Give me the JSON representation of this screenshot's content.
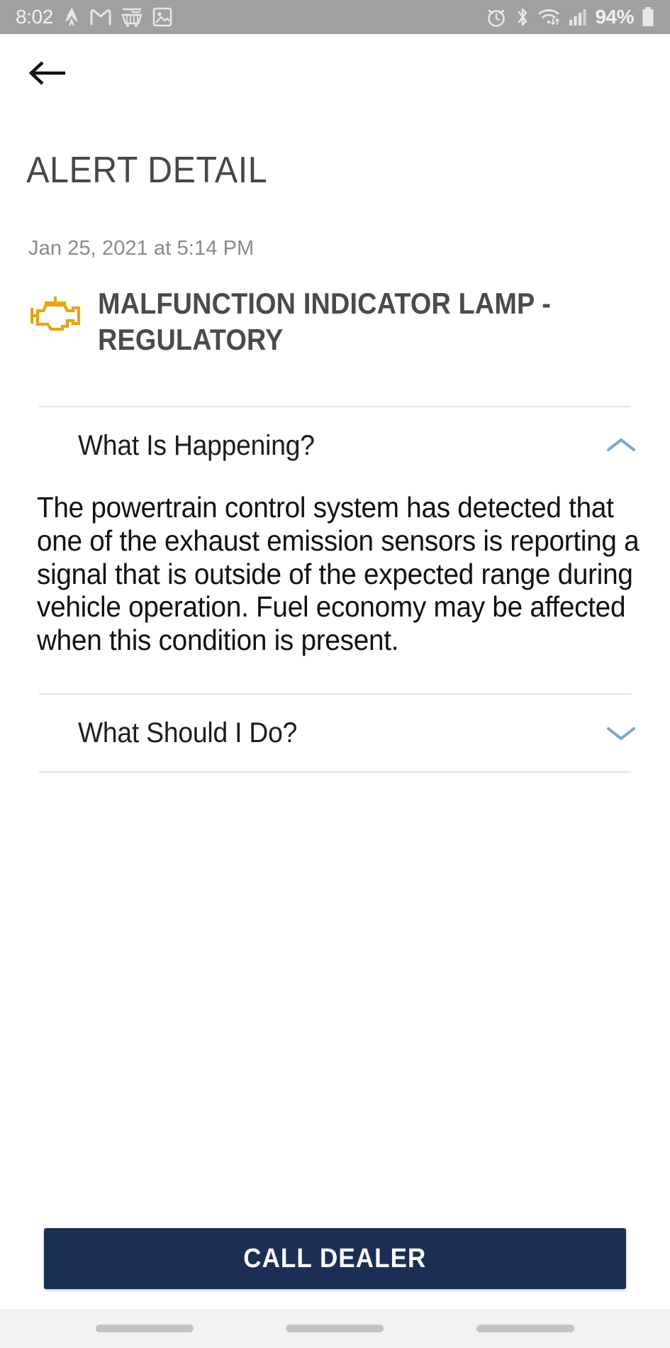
{
  "status_bar": {
    "time": "8:02",
    "battery_percent": "94%",
    "left_icons": [
      "time",
      "strava-icon",
      "gmail-icon",
      "amazon-cart-icon",
      "photos-icon"
    ],
    "right_icons": [
      "alarm-icon",
      "bluetooth-icon",
      "wifi-icon",
      "cellular-signal-icon",
      "battery-icon"
    ],
    "background_color": "#a0a0a0"
  },
  "nav": {
    "back_label": "back-arrow"
  },
  "header": {
    "page_title": "ALERT DETAIL"
  },
  "alert": {
    "timestamp": "Jan 25, 2021 at 5:14 PM",
    "icon": "check-engine-icon",
    "icon_color": "#e8a317",
    "title": "MALFUNCTION INDICATOR LAMP - REGULATORY"
  },
  "sections": [
    {
      "title": "What Is Happening?",
      "expanded": true,
      "chevron": "chevron-up-icon",
      "body": "The powertrain control system has detected that one of the exhaust emission sensors is reporting a signal that is outside of the expected range during vehicle operation. Fuel economy may be affected when this condition is present."
    },
    {
      "title": "What Should I Do?",
      "expanded": false,
      "chevron": "chevron-down-icon",
      "body": ""
    }
  ],
  "cta": {
    "label": "CALL DEALER",
    "background_color": "#1b2f55",
    "text_color": "#ffffff"
  },
  "system_nav": {
    "items": [
      "recents-pill",
      "home-pill",
      "back-pill"
    ]
  },
  "colors": {
    "accent_chevron": "#7fa8c4",
    "title_gray": "#474747",
    "date_gray": "#8a8a8a",
    "divider": "#e3e3e3"
  }
}
